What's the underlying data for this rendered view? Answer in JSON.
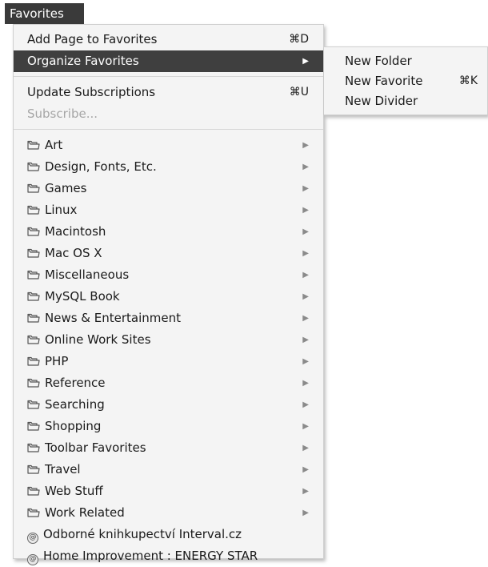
{
  "menubar": {
    "title": "Favorites"
  },
  "menu": {
    "top_items": [
      {
        "label": "Add Page to Favorites",
        "shortcut": "⌘D"
      },
      {
        "label": "Organize Favorites",
        "arrow": "▶"
      }
    ],
    "sub_items": [
      {
        "label": "Update Subscriptions",
        "shortcut": "⌘U"
      },
      {
        "label": "Subscribe..."
      }
    ],
    "folders": [
      {
        "label": "Art",
        "arrow": "▶"
      },
      {
        "label": "Design, Fonts, Etc.",
        "arrow": "▶"
      },
      {
        "label": "Games",
        "arrow": "▶"
      },
      {
        "label": "Linux",
        "arrow": "▶"
      },
      {
        "label": "Macintosh",
        "arrow": "▶"
      },
      {
        "label": "Mac OS X",
        "arrow": "▶"
      },
      {
        "label": "Miscellaneous",
        "arrow": "▶"
      },
      {
        "label": "MySQL Book",
        "arrow": "▶"
      },
      {
        "label": "News & Entertainment",
        "arrow": "▶"
      },
      {
        "label": "Online Work Sites",
        "arrow": "▶"
      },
      {
        "label": "PHP",
        "arrow": "▶"
      },
      {
        "label": "Reference",
        "arrow": "▶"
      },
      {
        "label": "Searching",
        "arrow": "▶"
      },
      {
        "label": "Shopping",
        "arrow": "▶"
      },
      {
        "label": "Toolbar Favorites",
        "arrow": "▶"
      },
      {
        "label": "Travel",
        "arrow": "▶"
      },
      {
        "label": "Web Stuff",
        "arrow": "▶"
      },
      {
        "label": "Work Related",
        "arrow": "▶"
      }
    ],
    "bookmarks": [
      {
        "label": "Odborné knihkupectví Interval.cz",
        "icon": "@"
      },
      {
        "label": "Home Improvement : ENERGY STAR",
        "icon": "@"
      }
    ]
  },
  "submenu": {
    "items": [
      {
        "label": "New Folder"
      },
      {
        "label": "New Favorite",
        "shortcut": "⌘K"
      },
      {
        "label": "New Divider"
      }
    ]
  }
}
